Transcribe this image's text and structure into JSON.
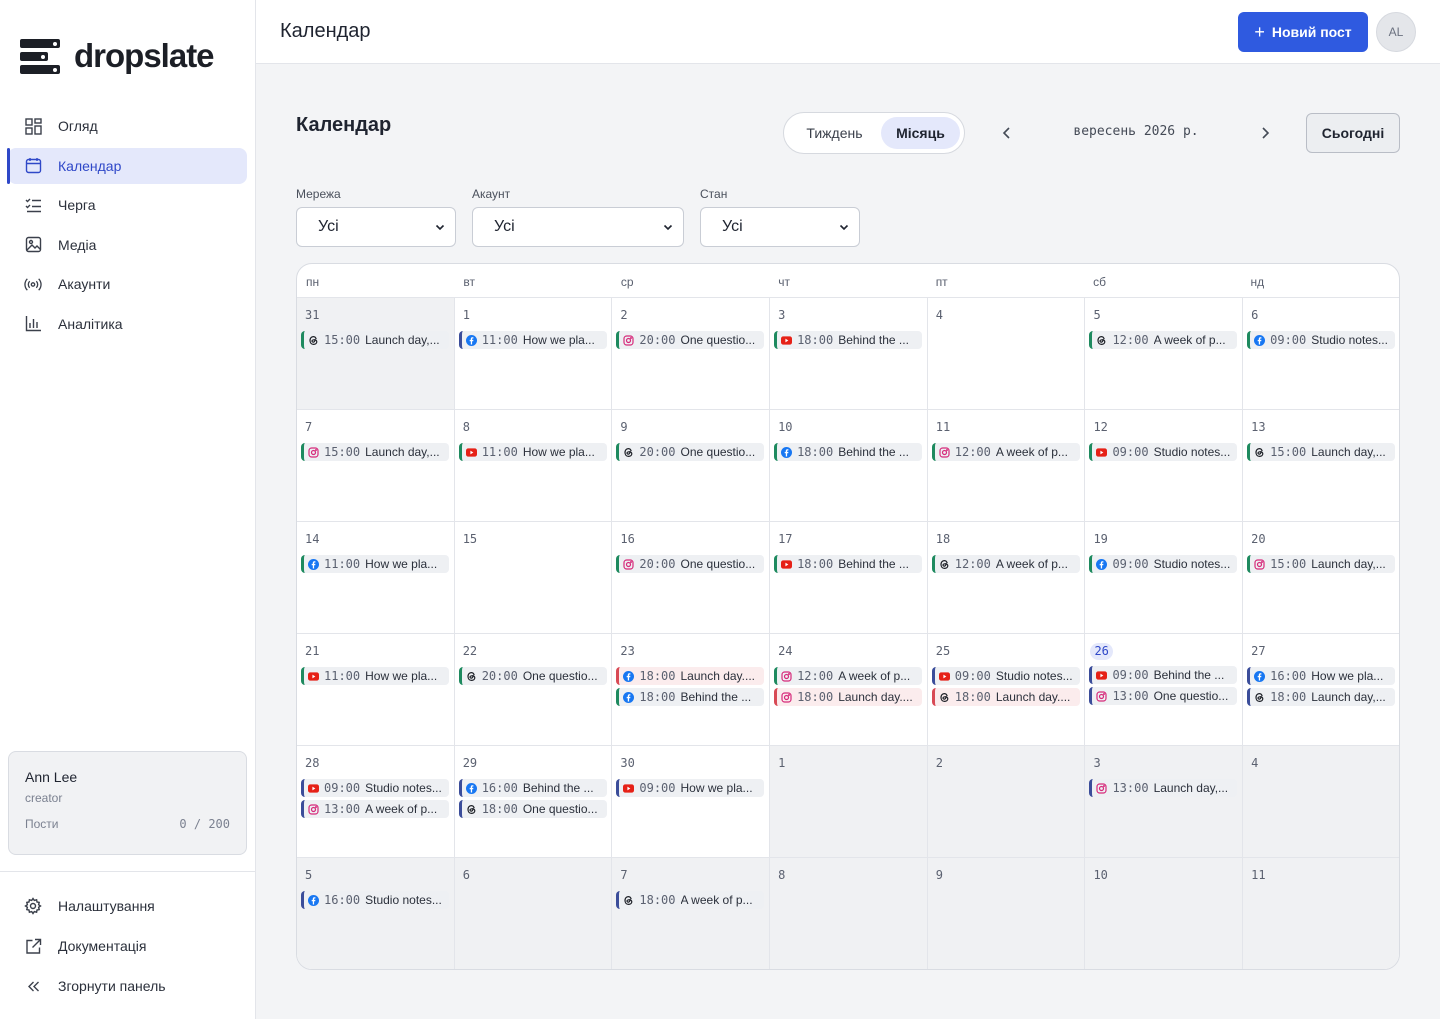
{
  "app": {
    "logo_text": "dropslate",
    "page_header": "Календар",
    "page_title": "Календар",
    "new_post_label": "Новий пост",
    "avatar_initials": "AL"
  },
  "sidebar": {
    "items": [
      {
        "label": "Огляд",
        "icon": "grid-icon",
        "active": false
      },
      {
        "label": "Календар",
        "icon": "calendar-icon",
        "active": true
      },
      {
        "label": "Черга",
        "icon": "queue-list-icon",
        "active": false
      },
      {
        "label": "Медіа",
        "icon": "image-icon",
        "active": false
      },
      {
        "label": "Акаунти",
        "icon": "broadcast-icon",
        "active": false
      },
      {
        "label": "Аналітика",
        "icon": "bar-chart-icon",
        "active": false
      }
    ],
    "user": {
      "name": "Ann Lee",
      "role": "creator",
      "posts_label": "Пости",
      "posts_count": "0 / 200"
    },
    "bottom_items": [
      {
        "label": "Налаштування",
        "icon": "gear-icon"
      },
      {
        "label": "Документація",
        "icon": "external-link-icon"
      },
      {
        "label": "Згорнути панель",
        "icon": "collapse-icon"
      }
    ]
  },
  "toolbar": {
    "view_week": "Тиждень",
    "view_month": "Місяць",
    "active_view": "month",
    "month_label": "вересень 2026 р.",
    "today_label": "Сьогодні"
  },
  "filters": [
    {
      "label": "Мережа",
      "value": "Усі"
    },
    {
      "label": "Акаунт",
      "value": "Усі"
    },
    {
      "label": "Стан",
      "value": "Усі"
    }
  ],
  "colors": {
    "accent": "#2f5ae0",
    "facebook": "#1877f2",
    "instagram": "#d6297a",
    "youtube": "#e62117",
    "threads": "#1c1f26",
    "status_published": "#1e8a5f",
    "status_draft": "#3b4d9a",
    "status_failed": "#d84a55"
  },
  "calendar": {
    "weekdays": [
      "пн",
      "вт",
      "ср",
      "чт",
      "пт",
      "сб",
      "нд"
    ],
    "weeks": [
      [
        {
          "day": "31",
          "muted": true,
          "events": [
            {
              "net": "threads",
              "time": "15:00",
              "text": "Launch day,...",
              "status": "pub"
            }
          ]
        },
        {
          "day": "1",
          "events": [
            {
              "net": "facebook",
              "time": "11:00",
              "text": "How we pla...",
              "status": "draft"
            }
          ]
        },
        {
          "day": "2",
          "events": [
            {
              "net": "instagram",
              "time": "20:00",
              "text": "One questio...",
              "status": "pub"
            }
          ]
        },
        {
          "day": "3",
          "events": [
            {
              "net": "youtube",
              "time": "18:00",
              "text": "Behind the ...",
              "status": "pub"
            }
          ]
        },
        {
          "day": "4",
          "events": []
        },
        {
          "day": "5",
          "events": [
            {
              "net": "threads",
              "time": "12:00",
              "text": "A week of p...",
              "status": "pub"
            }
          ]
        },
        {
          "day": "6",
          "events": [
            {
              "net": "facebook",
              "time": "09:00",
              "text": "Studio notes...",
              "status": "pub"
            }
          ]
        }
      ],
      [
        {
          "day": "7",
          "events": [
            {
              "net": "instagram",
              "time": "15:00",
              "text": "Launch day,...",
              "status": "pub"
            }
          ]
        },
        {
          "day": "8",
          "events": [
            {
              "net": "youtube",
              "time": "11:00",
              "text": "How we pla...",
              "status": "pub"
            }
          ]
        },
        {
          "day": "9",
          "events": [
            {
              "net": "threads",
              "time": "20:00",
              "text": "One questio...",
              "status": "pub"
            }
          ]
        },
        {
          "day": "10",
          "events": [
            {
              "net": "facebook",
              "time": "18:00",
              "text": "Behind the ...",
              "status": "pub"
            }
          ]
        },
        {
          "day": "11",
          "events": [
            {
              "net": "instagram",
              "time": "12:00",
              "text": "A week of p...",
              "status": "pub"
            }
          ]
        },
        {
          "day": "12",
          "events": [
            {
              "net": "youtube",
              "time": "09:00",
              "text": "Studio notes...",
              "status": "pub"
            }
          ]
        },
        {
          "day": "13",
          "events": [
            {
              "net": "threads",
              "time": "15:00",
              "text": "Launch day,...",
              "status": "pub"
            }
          ]
        }
      ],
      [
        {
          "day": "14",
          "events": [
            {
              "net": "facebook",
              "time": "11:00",
              "text": "How we pla...",
              "status": "pub"
            }
          ]
        },
        {
          "day": "15",
          "events": []
        },
        {
          "day": "16",
          "events": [
            {
              "net": "instagram",
              "time": "20:00",
              "text": "One questio...",
              "status": "pub"
            }
          ]
        },
        {
          "day": "17",
          "events": [
            {
              "net": "youtube",
              "time": "18:00",
              "text": "Behind the ...",
              "status": "pub"
            }
          ]
        },
        {
          "day": "18",
          "events": [
            {
              "net": "threads",
              "time": "12:00",
              "text": "A week of p...",
              "status": "pub"
            }
          ]
        },
        {
          "day": "19",
          "events": [
            {
              "net": "facebook",
              "time": "09:00",
              "text": "Studio notes...",
              "status": "pub"
            }
          ]
        },
        {
          "day": "20",
          "events": [
            {
              "net": "instagram",
              "time": "15:00",
              "text": "Launch day,...",
              "status": "pub"
            }
          ]
        }
      ],
      [
        {
          "day": "21",
          "events": [
            {
              "net": "youtube",
              "time": "11:00",
              "text": "How we pla...",
              "status": "pub"
            }
          ]
        },
        {
          "day": "22",
          "events": [
            {
              "net": "threads",
              "time": "20:00",
              "text": "One questio...",
              "status": "pub"
            }
          ]
        },
        {
          "day": "23",
          "events": [
            {
              "net": "facebook",
              "time": "18:00",
              "text": "Launch day....",
              "status": "fail"
            },
            {
              "net": "facebook",
              "time": "18:00",
              "text": "Behind the ...",
              "status": "pub"
            }
          ]
        },
        {
          "day": "24",
          "events": [
            {
              "net": "instagram",
              "time": "12:00",
              "text": "A week of p...",
              "status": "pub"
            },
            {
              "net": "instagram",
              "time": "18:00",
              "text": "Launch day....",
              "status": "fail"
            }
          ]
        },
        {
          "day": "25",
          "events": [
            {
              "net": "youtube",
              "time": "09:00",
              "text": "Studio notes...",
              "status": "draft"
            },
            {
              "net": "threads",
              "time": "18:00",
              "text": "Launch day....",
              "status": "fail"
            }
          ]
        },
        {
          "day": "26",
          "today": true,
          "events": [
            {
              "net": "youtube",
              "time": "09:00",
              "text": "Behind the ...",
              "status": "draft"
            },
            {
              "net": "instagram",
              "time": "13:00",
              "text": "One questio...",
              "status": "draft"
            }
          ]
        },
        {
          "day": "27",
          "events": [
            {
              "net": "facebook",
              "time": "16:00",
              "text": "How we pla...",
              "status": "draft"
            },
            {
              "net": "threads",
              "time": "18:00",
              "text": "Launch day,...",
              "status": "draft"
            }
          ]
        }
      ],
      [
        {
          "day": "28",
          "events": [
            {
              "net": "youtube",
              "time": "09:00",
              "text": "Studio notes...",
              "status": "draft"
            },
            {
              "net": "instagram",
              "time": "13:00",
              "text": "A week of p...",
              "status": "draft"
            }
          ]
        },
        {
          "day": "29",
          "events": [
            {
              "net": "facebook",
              "time": "16:00",
              "text": "Behind the ...",
              "status": "draft"
            },
            {
              "net": "threads",
              "time": "18:00",
              "text": "One questio...",
              "status": "draft"
            }
          ]
        },
        {
          "day": "30",
          "events": [
            {
              "net": "youtube",
              "time": "09:00",
              "text": "How we pla...",
              "status": "draft"
            }
          ]
        },
        {
          "day": "1",
          "muted": true,
          "events": []
        },
        {
          "day": "2",
          "muted": true,
          "events": []
        },
        {
          "day": "3",
          "muted": true,
          "events": [
            {
              "net": "instagram",
              "time": "13:00",
              "text": "Launch day,...",
              "status": "draft"
            }
          ]
        },
        {
          "day": "4",
          "muted": true,
          "events": []
        }
      ],
      [
        {
          "day": "5",
          "muted": true,
          "events": [
            {
              "net": "facebook",
              "time": "16:00",
              "text": "Studio notes...",
              "status": "draft"
            }
          ]
        },
        {
          "day": "6",
          "muted": true,
          "events": []
        },
        {
          "day": "7",
          "muted": true,
          "events": [
            {
              "net": "threads",
              "time": "18:00",
              "text": "A week of p...",
              "status": "draft"
            }
          ]
        },
        {
          "day": "8",
          "muted": true,
          "events": []
        },
        {
          "day": "9",
          "muted": true,
          "events": []
        },
        {
          "day": "10",
          "muted": true,
          "events": []
        },
        {
          "day": "11",
          "muted": true,
          "events": []
        }
      ]
    ]
  }
}
